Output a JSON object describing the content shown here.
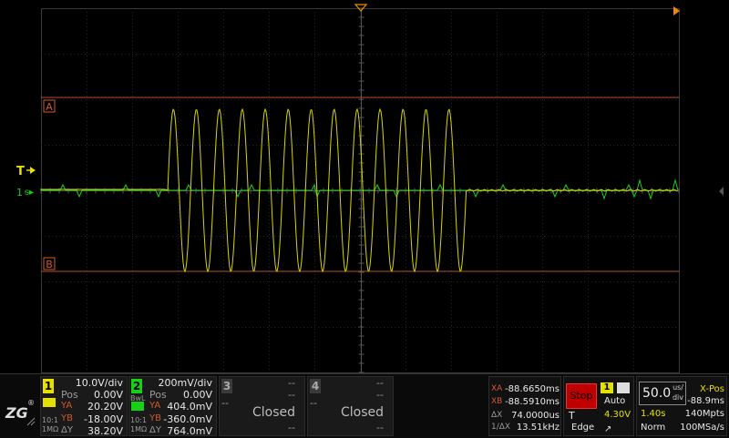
{
  "scope": {
    "trigger_marker": "T",
    "channel_marker": "1",
    "cursor_a_label": "A",
    "cursor_b_label": "B"
  },
  "ch1": {
    "number": "1",
    "scale": "10.0V/div",
    "pos_label": "Pos",
    "pos_value": "0.00V",
    "ya_label": "YA",
    "ya_value": "20.20V",
    "yb_label": "YB",
    "yb_value": "-18.00V",
    "dy_label": "ΔY",
    "dy_value": "38.20V",
    "probe": "10:1",
    "impedance": "1MΩ"
  },
  "ch2": {
    "number": "2",
    "scale": "200mV/div",
    "pos_label": "Pos",
    "pos_value": "0.00V",
    "ya_label": "YA",
    "ya_value": "404.0mV",
    "yb_label": "YB",
    "yb_value": "-360.0mV",
    "dy_label": "ΔY",
    "dy_value": "764.0mV",
    "probe": "10:1",
    "impedance": "1MΩ",
    "bw_label": "BwL"
  },
  "ch3": {
    "number": "3",
    "state": "Closed",
    "dash": "--"
  },
  "ch4": {
    "number": "4",
    "state": "Closed",
    "dash": "--"
  },
  "cursors": {
    "xa_label": "XA",
    "xa_value": "-88.6650ms",
    "xb_label": "XB",
    "xb_value": "-88.5910ms",
    "dx_label": "ΔX",
    "dx_value": "74.0000us",
    "inv_dx_label": "1/ΔX",
    "inv_dx_value": "13.51kHz"
  },
  "run": {
    "status": "Stop",
    "trigger_label": "T",
    "trigger_mode_label": "Edge"
  },
  "trigger": {
    "channel": "1",
    "mode": "Auto",
    "level": "4.30V"
  },
  "timebase": {
    "scale_value": "50.0",
    "scale_unit_top": "us/",
    "scale_unit_bottom": "div",
    "xpos_label": "X-Pos",
    "xpos_value": "-88.9ms",
    "time_value": "1.40s",
    "mem_depth": "140Mpts",
    "acq_mode": "Norm",
    "sample_rate": "100MSa/s"
  },
  "brand": {
    "logo": "ZLG"
  },
  "colors": {
    "ch1": "#e6e000",
    "ch2": "#19d019",
    "cursor": "#d25a2a",
    "trigger": "#f08a00"
  }
}
